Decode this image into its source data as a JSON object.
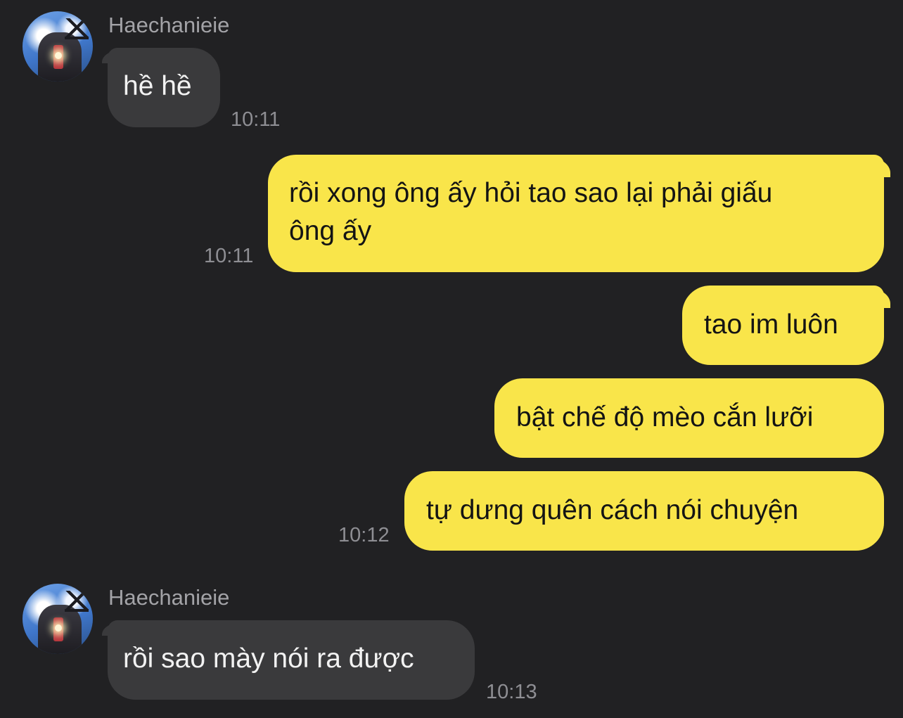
{
  "colors": {
    "background": "#212123",
    "incoming_bubble": "#3a3a3c",
    "outgoing_bubble": "#f9e54a",
    "timestamp": "#8e8e93"
  },
  "messages": [
    {
      "sender": "Haechanieie",
      "text": "hề hề",
      "time": "10:11"
    },
    {
      "text_line1": "rồi xong ông ấy hỏi tao sao lại phải giấu",
      "text_line2": "ông ấy",
      "time": "10:11"
    },
    {
      "text": "tao im luôn"
    },
    {
      "text": "bật chế độ mèo cắn lưỡi"
    },
    {
      "text": "tự dưng quên cách nói chuyện",
      "time": "10:12"
    },
    {
      "sender": "Haechanieie",
      "text": "rồi sao mày nói ra được",
      "time": "10:13"
    }
  ]
}
